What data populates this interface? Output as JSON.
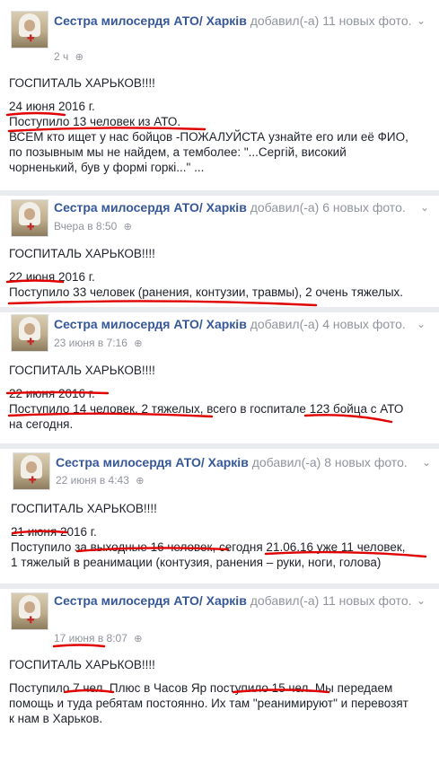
{
  "posts": [
    {
      "author": "Сестра милосердя АТО/ Харків",
      "action": "добавил(-а) 11 новых фото.",
      "time": "2 ч",
      "lines": [
        "ГОСПИТАЛЬ ХАРЬКОВ!!!!",
        "",
        "24 июня 2016 г.",
        "Поступило 13 человек из АТО.",
        "ВСЕМ кто ищет у нас бойцов -ПОЖАЛУЙСТА узнайте его или её ФИО,",
        "по позывным мы не найдем, а темболее: \"...Сергій, високий",
        "чорненький, був у формі горкі...\" ..."
      ]
    },
    {
      "author": "Сестра милосердя АТО/ Харків",
      "action": "добавил(-а) 6 новых фото.",
      "time": "Вчера в 8:50",
      "lines": [
        "ГОСПИТАЛЬ ХАРЬКОВ!!!!",
        "",
        "22 июня 2016 г.",
        "Поступило 33 человек (ранения, контузии, травмы), 2 очень тяжелых."
      ]
    },
    {
      "author": "Сестра милосердя АТО/ Харків",
      "action": "добавил(-а) 4 новых фото.",
      "time": "23 июня в 7:16",
      "lines": [
        "ГОСПИТАЛЬ ХАРЬКОВ!!!!",
        "",
        "22 июня 2016 г.",
        "Поступило 14 человек, 2 тяжелых, всего в госпитале 123 бойца с АТО",
        "на сегодня."
      ]
    },
    {
      "author": "Сестра милосердя АТО/ Харків",
      "action": "добавил(-а) 8 новых фото.",
      "time": "22 июня в 4:43",
      "lines": [
        "ГОСПИТАЛЬ ХАРЬКОВ!!!!",
        "",
        "21 июня 2016 г.",
        "Поступило за выходные 16 человек, сегодня 21.06.16 уже 11 человек,",
        "1 тяжелый в реанимации (контузия, ранения – руки, ноги, голова)"
      ]
    },
    {
      "author": "Сестра милосердя АТО/ Харків",
      "action": "добавил(-а) 11 новых фото.",
      "time": "17 июня в 8:07",
      "lines": [
        "ГОСПИТАЛЬ ХАРЬКОВ!!!!",
        "",
        "Поступило 7 чел. Плюс в Часов Яр поступило 15 чел. Мы передаем",
        "помощь и туда ребятам постоянно. Их там \"реанимируют\" и перевозят",
        "к нам в Харьков."
      ]
    }
  ],
  "colors": {
    "author": "#365899",
    "annotation": "#e00000",
    "meta": "#90949c"
  },
  "icons": {
    "privacy": "globe-icon",
    "menu": "chevron-down-icon"
  }
}
